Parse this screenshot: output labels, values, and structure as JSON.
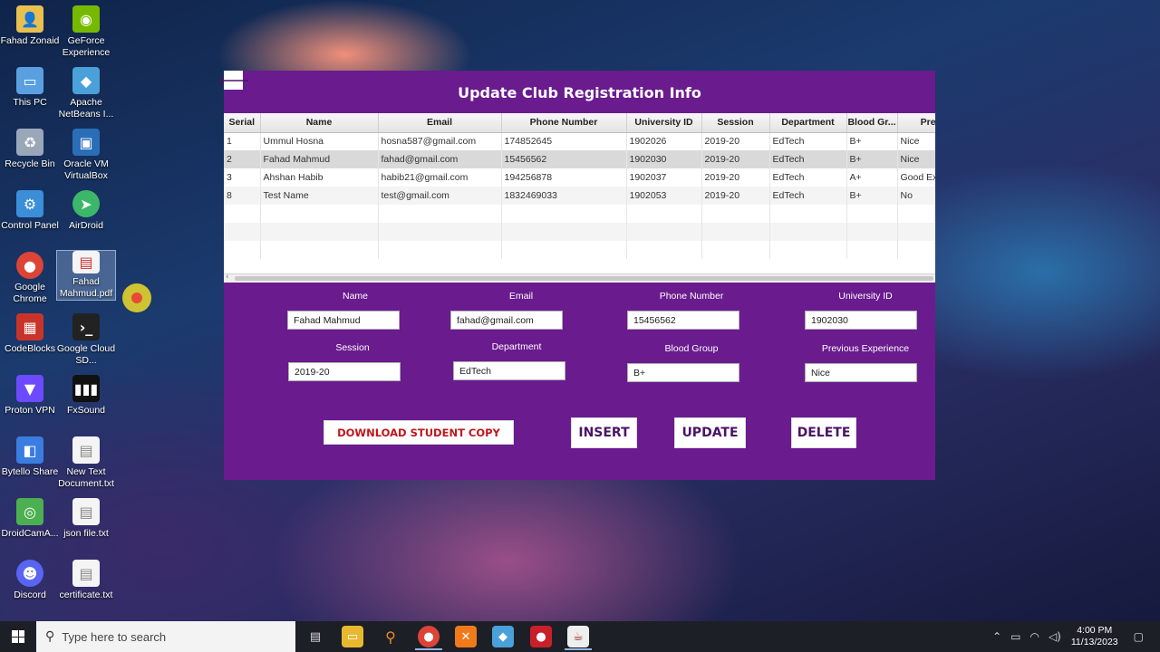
{
  "desktop_icons": [
    {
      "label": "Fahad Zonaid",
      "icon": "folder-user-icon",
      "color": "#e8c050"
    },
    {
      "label": "GeForce Experience",
      "icon": "geforce-icon",
      "color": "#76b900"
    },
    {
      "label": "This PC",
      "icon": "computer-icon",
      "color": "#5aa0e0"
    },
    {
      "label": "Apache NetBeans I...",
      "icon": "netbeans-icon",
      "color": "#4aa0d8"
    },
    {
      "label": "Recycle Bin",
      "icon": "recycle-bin-icon",
      "color": "#9aa7b8"
    },
    {
      "label": "Oracle VM VirtualBox",
      "icon": "virtualbox-icon",
      "color": "#2a6eb8"
    },
    {
      "label": "Control Panel",
      "icon": "control-panel-icon",
      "color": "#3b8ed8"
    },
    {
      "label": "AirDroid",
      "icon": "airdroid-icon",
      "color": "#3cb76a"
    },
    {
      "label": "Google Chrome",
      "icon": "chrome-icon",
      "color": "#db4437"
    },
    {
      "label": "Fahad Mahmud.pdf",
      "icon": "pdf-file-icon",
      "color": "#f4f4f4"
    },
    {
      "label": "CodeBlocks",
      "icon": "codeblocks-icon",
      "color": "#c8342a"
    },
    {
      "label": "Google Cloud SD...",
      "icon": "terminal-icon",
      "color": "#222222"
    },
    {
      "label": "Proton VPN",
      "icon": "proton-vpn-icon",
      "color": "#6d4aff"
    },
    {
      "label": "FxSound",
      "icon": "fxsound-icon",
      "color": "#111111"
    },
    {
      "label": "Bytello Share",
      "icon": "bytello-icon",
      "color": "#3a7de0"
    },
    {
      "label": "New Text Document.txt",
      "icon": "text-file-icon",
      "color": "#f4f4f4"
    },
    {
      "label": "DroidCamA...",
      "icon": "droidcam-icon",
      "color": "#4caf50"
    },
    {
      "label": "json file.txt",
      "icon": "text-file-icon",
      "color": "#f4f4f4"
    },
    {
      "label": "Discord",
      "icon": "discord-icon",
      "color": "#5865f2"
    },
    {
      "label": "certificate.txt",
      "icon": "text-file-icon",
      "color": "#f4f4f4"
    }
  ],
  "app": {
    "title": "Update Club Registration Info",
    "back_glyph": "🡐",
    "table": {
      "columns": [
        "Serial",
        "Name",
        "Email",
        "Phone Number",
        "University ID",
        "Session",
        "Department",
        "Blood Gr...",
        "Previ"
      ],
      "rows": [
        [
          "1",
          "Ummul Hosna",
          "hosna587@gmail.com",
          "174852645",
          "1902026",
          "2019-20",
          "EdTech",
          "B+",
          "Nice"
        ],
        [
          "2",
          "Fahad Mahmud",
          "fahad@gmail.com",
          "15456562",
          "1902030",
          "2019-20",
          "EdTech",
          "B+",
          "Nice"
        ],
        [
          "3",
          "Ahshan Habib",
          "habib21@gmail.com",
          "194256878",
          "1902037",
          "2019-20",
          "EdTech",
          "A+",
          "Good Exp"
        ],
        [
          "8",
          "Test Name",
          "test@gmail.com",
          "1832469033",
          "1902053",
          "2019-20",
          "EdTech",
          "B+",
          "No"
        ]
      ]
    },
    "form": {
      "name_label": "Name",
      "name_value": "Fahad Mahmud",
      "email_label": "Email",
      "email_value": "fahad@gmail.com",
      "phone_label": "Phone Number",
      "phone_value": "15456562",
      "uid_label": "University ID",
      "uid_value": "1902030",
      "session_label": "Session",
      "session_value": "2019-20",
      "dept_label": "Department",
      "dept_value": "EdTech",
      "blood_label": "Blood Group",
      "blood_value": "B+",
      "exp_label": "Previous Experience",
      "exp_value": "Nice"
    },
    "buttons": {
      "download": "DOWNLOAD STUDENT COPY",
      "insert": "INSERT",
      "update": "UPDATE",
      "delete": "DELETE"
    }
  },
  "taskbar": {
    "search_placeholder": "Type here to search",
    "time": "4:00 PM",
    "date": "11/13/2023"
  }
}
